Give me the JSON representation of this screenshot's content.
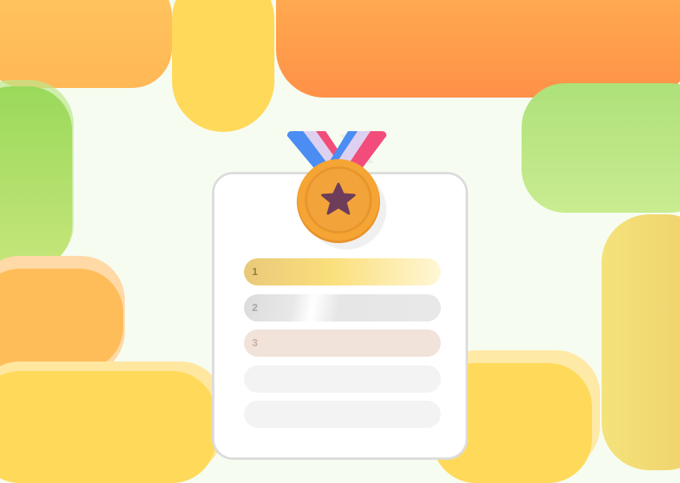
{
  "leaderboard": {
    "ranks": [
      {
        "label": "1"
      },
      {
        "label": "2"
      },
      {
        "label": "3"
      },
      {
        "label": ""
      },
      {
        "label": ""
      }
    ]
  },
  "colors": {
    "gold": "#f2d27a",
    "silver": "#e2e2e2",
    "bronze": "#f1e1da",
    "empty": "#f2f2f2",
    "medal": "#f5a533",
    "star": "#6d3d5a"
  },
  "icons": [
    "medal-icon",
    "star-icon"
  ]
}
